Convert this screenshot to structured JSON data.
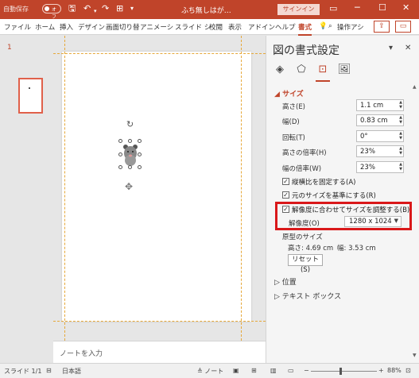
{
  "titlebar": {
    "autosave_label": "自動保存",
    "autosave_state": "オフ",
    "doc_title": "ふち無しはが…",
    "signin_label": "サインイン",
    "minimize": "─",
    "restore": "☐",
    "close": "✕"
  },
  "ribbon": {
    "tabs": [
      "ファイル",
      "ホーム",
      "挿入",
      "デザイン",
      "画面切り替",
      "アニメーシ",
      "スライド シ",
      "校閲",
      "表示",
      "アドイン",
      "ヘルプ",
      "書式"
    ],
    "active_tab": "書式",
    "search_label": "操作アシ"
  },
  "thumbnails": {
    "slide_number": "1"
  },
  "notes_placeholder": "ノートを入力",
  "format_pane": {
    "title": "図の書式設定",
    "size_section": "サイズ",
    "height_label": "高さ(E)",
    "height_value": "1.1 cm",
    "width_label": "幅(D)",
    "width_value": "0.83 cm",
    "rotation_label": "回転(T)",
    "rotation_value": "0°",
    "scale_height_label": "高さの倍率(H)",
    "scale_height_value": "23%",
    "scale_width_label": "幅の倍率(W)",
    "scale_width_value": "23%",
    "lock_aspect_label": "縦横比を固定する(A)",
    "relative_original_label": "元のサイズを基準にする(R)",
    "best_scale_label": "解像度に合わせてサイズを調整する(B)",
    "resolution_label": "解像度(O)",
    "resolution_value": "1280 x 1024",
    "original_size_label": "原型のサイズ",
    "original_height": "高さ:  4.69 cm",
    "original_width": "幅:  3.53 cm",
    "reset_label": "リセット(S)",
    "position_section": "位置",
    "textbox_section": "テキスト ボックス"
  },
  "status": {
    "slide_info": "スライド 1/1",
    "language": "日本語",
    "notes_label": "ノート",
    "zoom": "88%"
  },
  "colors": {
    "accent": "#c0442a",
    "highlight": "#d9181a"
  }
}
